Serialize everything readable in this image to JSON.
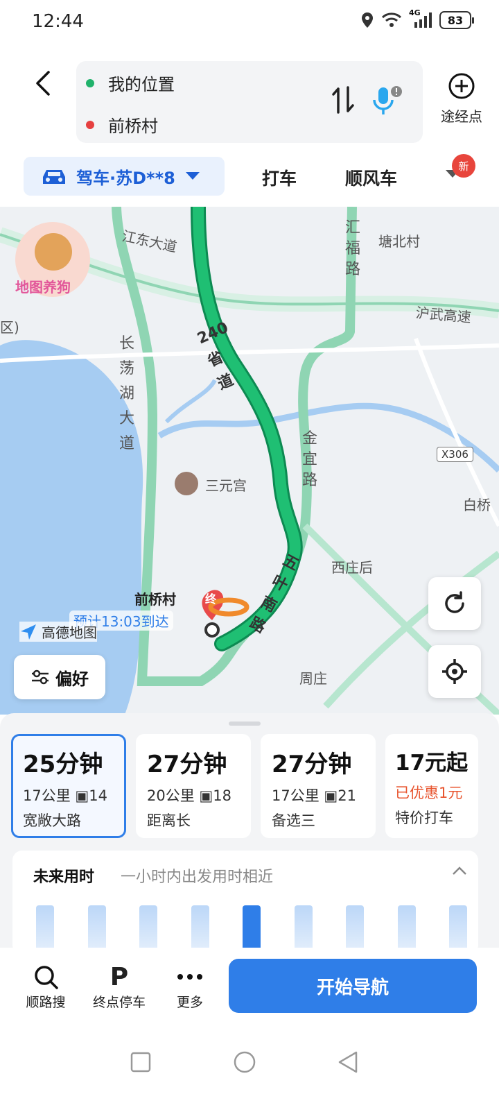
{
  "status": {
    "time": "12:44",
    "network": "4G",
    "battery": "83"
  },
  "route": {
    "origin": "我的位置",
    "destination": "前桥村",
    "waypoint_label": "途经点"
  },
  "modes": {
    "drive": "驾车·苏D**8",
    "taxi": "打车",
    "ride": "顺风车",
    "new_badge": "新"
  },
  "map": {
    "poi_mascot": "地图养狗",
    "labels": {
      "jiangdong": "江东大道",
      "huifu": "汇福路",
      "tangbei": "塘北村",
      "huwu": "沪武高速",
      "changdang": "长荡湖大道",
      "s240": "240省道",
      "jinyi": "金宜路",
      "x306": "X306",
      "sanyuan": "三元宫",
      "baiqiao": "白桥",
      "xizhuang": "西庄后",
      "wuye": "五叶南路",
      "zhouzhuang": "周庄",
      "dest_marker": "前桥村",
      "end_tag": "终",
      "eta": "预计13:03到达",
      "brand": "高德地图",
      "left_edge": "区)"
    },
    "preference": "偏好"
  },
  "routes": [
    {
      "time": "25分钟",
      "dist": "17公里",
      "lights": "14",
      "tag": "宽敞大路",
      "selected": true
    },
    {
      "time": "27分钟",
      "dist": "20公里",
      "lights": "18",
      "tag": "距离长",
      "selected": false
    },
    {
      "time": "27分钟",
      "dist": "17公里",
      "lights": "21",
      "tag": "备选三",
      "selected": false
    }
  ],
  "taxi_card": {
    "price": "17元起",
    "promo": "已优惠1元",
    "label": "特价打车"
  },
  "future": {
    "title": "未来用时",
    "subtitle": "一小时内出发用时相近",
    "bars": [
      0.52,
      0.52,
      0.52,
      0.52,
      0.52,
      0.52,
      0.52,
      0.52,
      0.52
    ],
    "selected_index": 4
  },
  "bottom": {
    "search": "顺路搜",
    "parking": "终点停车",
    "more": "更多",
    "start": "开始导航",
    "parking_glyph": "P"
  },
  "colors": {
    "accent": "#2f7ee8",
    "route": "#18b06a",
    "water": "#a6ccf2"
  }
}
